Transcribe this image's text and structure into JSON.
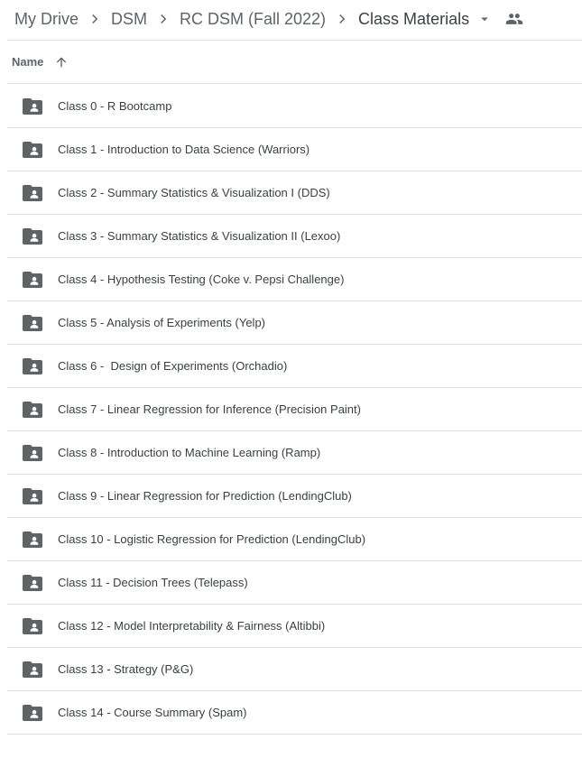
{
  "breadcrumb": {
    "items": [
      "My Drive",
      "DSM",
      "RC DSM (Fall 2022)",
      "Class Materials"
    ]
  },
  "header": {
    "name_label": "Name"
  },
  "files": [
    {
      "name": "Class 0 - R Bootcamp"
    },
    {
      "name": "Class 1 - Introduction to Data Science (Warriors)"
    },
    {
      "name": "Class 2 - Summary Statistics & Visualization I (DDS)"
    },
    {
      "name": "Class 3 - Summary Statistics & Visualization II (Lexoo)"
    },
    {
      "name": "Class 4 - Hypothesis Testing (Coke v. Pepsi Challenge)"
    },
    {
      "name": "Class 5 - Analysis of Experiments (Yelp)"
    },
    {
      "name": "Class 6 -  Design of Experiments (Orchadio)"
    },
    {
      "name": "Class 7 - Linear Regression for Inference (Precision Paint)"
    },
    {
      "name": "Class 8 - Introduction to Machine Learning (Ramp)"
    },
    {
      "name": "Class 9 - Linear Regression for Prediction (LendingClub)"
    },
    {
      "name": "Class 10 - Logistic Regression for Prediction (LendingClub)"
    },
    {
      "name": "Class 11 - Decision Trees (Telepass)"
    },
    {
      "name": "Class 12 - Model Interpretability & Fairness (Altibbi)"
    },
    {
      "name": "Class 13 - Strategy (P&G)"
    },
    {
      "name": "Class 14 - Course Summary (Spam)"
    }
  ],
  "icons": {
    "breadcrumb_separator": "chevron-right-icon",
    "folder_menu": "caret-down-icon",
    "shared": "people-icon",
    "sort": "arrow-up-icon",
    "row": "shared-folder-icon"
  },
  "colors": {
    "icon_gray": "#5f6368",
    "text": "#3c4043",
    "divider": "#e0e0e0"
  }
}
